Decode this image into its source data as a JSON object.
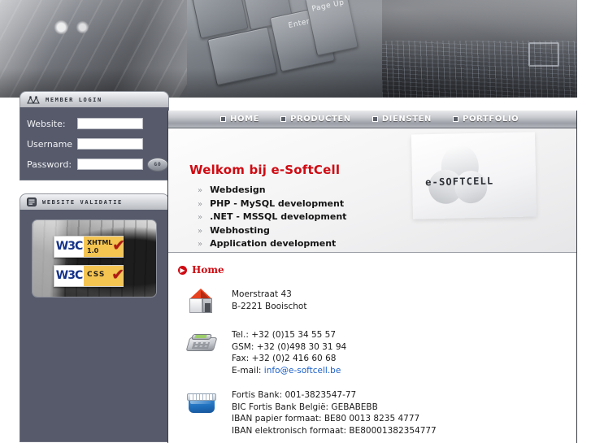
{
  "site": {
    "name": "e-SoftCell",
    "accent_red": "#cf0a12",
    "sidebar_bg": "#565a6b",
    "link_blue": "#1b5fc7"
  },
  "banner": {
    "alt": "keyboard-collage-banner",
    "keys": [
      {
        "label": ""
      },
      {
        "label": ""
      },
      {
        "label": ""
      },
      {
        "label": "Enter"
      },
      {
        "label": "Page Up"
      }
    ]
  },
  "sidebar": {
    "login_panel": {
      "icon": "members-icon",
      "title": "MEMBER LOGIN",
      "fields": [
        {
          "label": "Website:",
          "value": "",
          "placeholder": "",
          "name": "website-field"
        },
        {
          "label": "Username",
          "value": "",
          "placeholder": "",
          "name": "username-field"
        },
        {
          "label": "Password:",
          "value": "",
          "placeholder": "",
          "name": "password-field"
        }
      ],
      "submit_label": "GO"
    },
    "validation_panel": {
      "icon": "monitor-icon",
      "title": "WEBSITE VALIDATIE",
      "badges": [
        {
          "mark": "W3C",
          "line1": "XHTML",
          "line2": "1.0",
          "check": "✔"
        },
        {
          "mark": "W3C",
          "line1": "CSS",
          "line2": "",
          "check": "✔"
        }
      ]
    }
  },
  "nav": {
    "items": [
      {
        "label": "HOME",
        "bullet": "square-bullet-icon"
      },
      {
        "label": "PRODUCTEN",
        "bullet": "square-bullet-icon"
      },
      {
        "label": "DIENSTEN",
        "bullet": "square-bullet-icon"
      },
      {
        "label": "PORTFOLIO",
        "bullet": "square-bullet-icon"
      }
    ]
  },
  "hero": {
    "title": "Welkom bij e-SoftCell",
    "chevron": "»",
    "services": [
      "Webdesign",
      "PHP - MySQL development",
      ".NET - MSSQL development",
      "Webhosting",
      "Application development"
    ],
    "logo_text": "e-SOFTCELL"
  },
  "content": {
    "breadcrumb": {
      "icon": "▶",
      "label": "Home"
    },
    "blocks": [
      {
        "icon": "house-icon",
        "lines": [
          "Moerstraat 43",
          "B-2221 Booischot"
        ]
      },
      {
        "icon": "phone-icon",
        "lines": [
          "Tel.: +32 (0)15 34 55 57",
          "GSM: +32 (0)498 30 31 94",
          "Fax: +32 (0)2 416 60 68"
        ],
        "email_label": "E-mail: ",
        "email": "info@e-softcell.be"
      },
      {
        "icon": "bank-icon",
        "lines": [
          "Fortis Bank: 001-3823547-77",
          "BIC Fortis Bank België: GEBABEBB",
          "IBAN papier formaat: BE80 0013 8235 4777",
          "IBAN elektronisch formaat: BE80001382354777"
        ]
      }
    ]
  }
}
